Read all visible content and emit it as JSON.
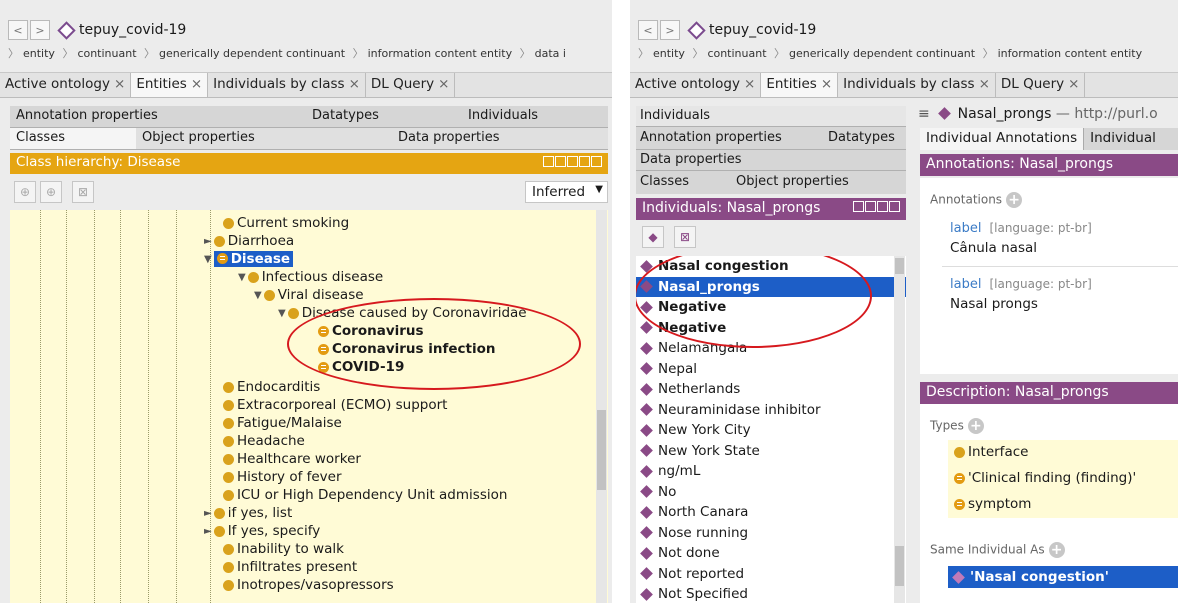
{
  "left": {
    "nav": {
      "back": "<",
      "fwd": ">",
      "ontology_name": "tepuy_covid-19"
    },
    "breadcrumb": [
      "entity",
      "continuant",
      "generically dependent continuant",
      "information content entity",
      "data i"
    ],
    "tabs": [
      {
        "label": "Active ontology",
        "close": "×"
      },
      {
        "label": "Entities",
        "close": "×"
      },
      {
        "label": "Individuals by class",
        "close": "×"
      },
      {
        "label": "DL Query",
        "close": "×"
      }
    ],
    "subtabs_row1": [
      "Annotation properties",
      "Datatypes",
      "Individuals"
    ],
    "subtabs_row2": [
      "Classes",
      "Object properties",
      "Data properties"
    ],
    "hierarchy_title": "Class hierarchy: Disease",
    "inferred_select": "Inferred",
    "tree": {
      "current_smoking": "Current smoking",
      "diarrhoea": "Diarrhoea",
      "disease": "Disease",
      "infectious_disease": "Infectious disease",
      "viral_disease": "Viral disease",
      "disease_caused": "Disease caused by Coronaviridae",
      "coronavirus": "Coronavirus",
      "coronavirus_infection": "Coronavirus infection",
      "covid19": "COVID-19",
      "rest": [
        "Endocarditis",
        "Extracorporeal (ECMO) support",
        "Fatigue/Malaise",
        "Headache",
        "Healthcare worker",
        "History of fever",
        "ICU or High Dependency Unit admission",
        "if yes, list",
        "If yes, specify",
        "Inability to walk",
        "Infiltrates present",
        "Inotropes/vasopressors"
      ]
    }
  },
  "right": {
    "nav": {
      "back": "<",
      "fwd": ">",
      "ontology_name": "tepuy_covid-19"
    },
    "breadcrumb": [
      "entity",
      "continuant",
      "generically dependent continuant",
      "information content entity"
    ],
    "tabs": [
      {
        "label": "Active ontology",
        "close": "×"
      },
      {
        "label": "Entities",
        "close": "×"
      },
      {
        "label": "Individuals by class",
        "close": "×"
      },
      {
        "label": "DL Query",
        "close": "×"
      }
    ],
    "side_tabs": {
      "row1": [
        "Individuals"
      ],
      "row2": [
        "Annotation properties",
        "Datatypes"
      ],
      "row3": [
        "Data properties"
      ],
      "row4": [
        "Classes",
        "Object properties"
      ]
    },
    "individuals_title": "Individuals: Nasal_prongs",
    "individuals": [
      "Nasal congestion",
      "Nasal_prongs",
      "Negative",
      "Negative",
      "Nelamangala",
      "Nepal",
      "Netherlands",
      "Neuraminidase inhibitor",
      "New York City",
      "New York State",
      "ng/mL",
      "No",
      "North Canara",
      "Nose running",
      "Not done",
      "Not reported",
      "Not Specified"
    ],
    "entity_header": {
      "name": "Nasal_prongs",
      "iri": "— http://purl.o"
    },
    "entity_tabs": [
      "Individual Annotations",
      "Individual"
    ],
    "annotations_title": "Annotations: Nasal_prongs",
    "annotations_label": "Annotations",
    "annotations": [
      {
        "prop": "label",
        "lang": "[language: pt-br]",
        "value": "Cânula nasal"
      },
      {
        "prop": "label",
        "lang": "[language: pt-br]",
        "value": "Nasal prongs"
      }
    ],
    "description_title": "Description: Nasal_prongs",
    "types_label": "Types",
    "types": [
      "Interface",
      "'Clinical finding (finding)'",
      "symptom"
    ],
    "same_as_label": "Same Individual As",
    "same_as": "'Nasal congestion'"
  },
  "colors": {
    "orange_header": "#e5a512",
    "purple_header": "#8a4a86",
    "selection": "#1d5ec7",
    "highlight_ellipse": "#d6191e",
    "tree_bg": "#fffbd6"
  }
}
